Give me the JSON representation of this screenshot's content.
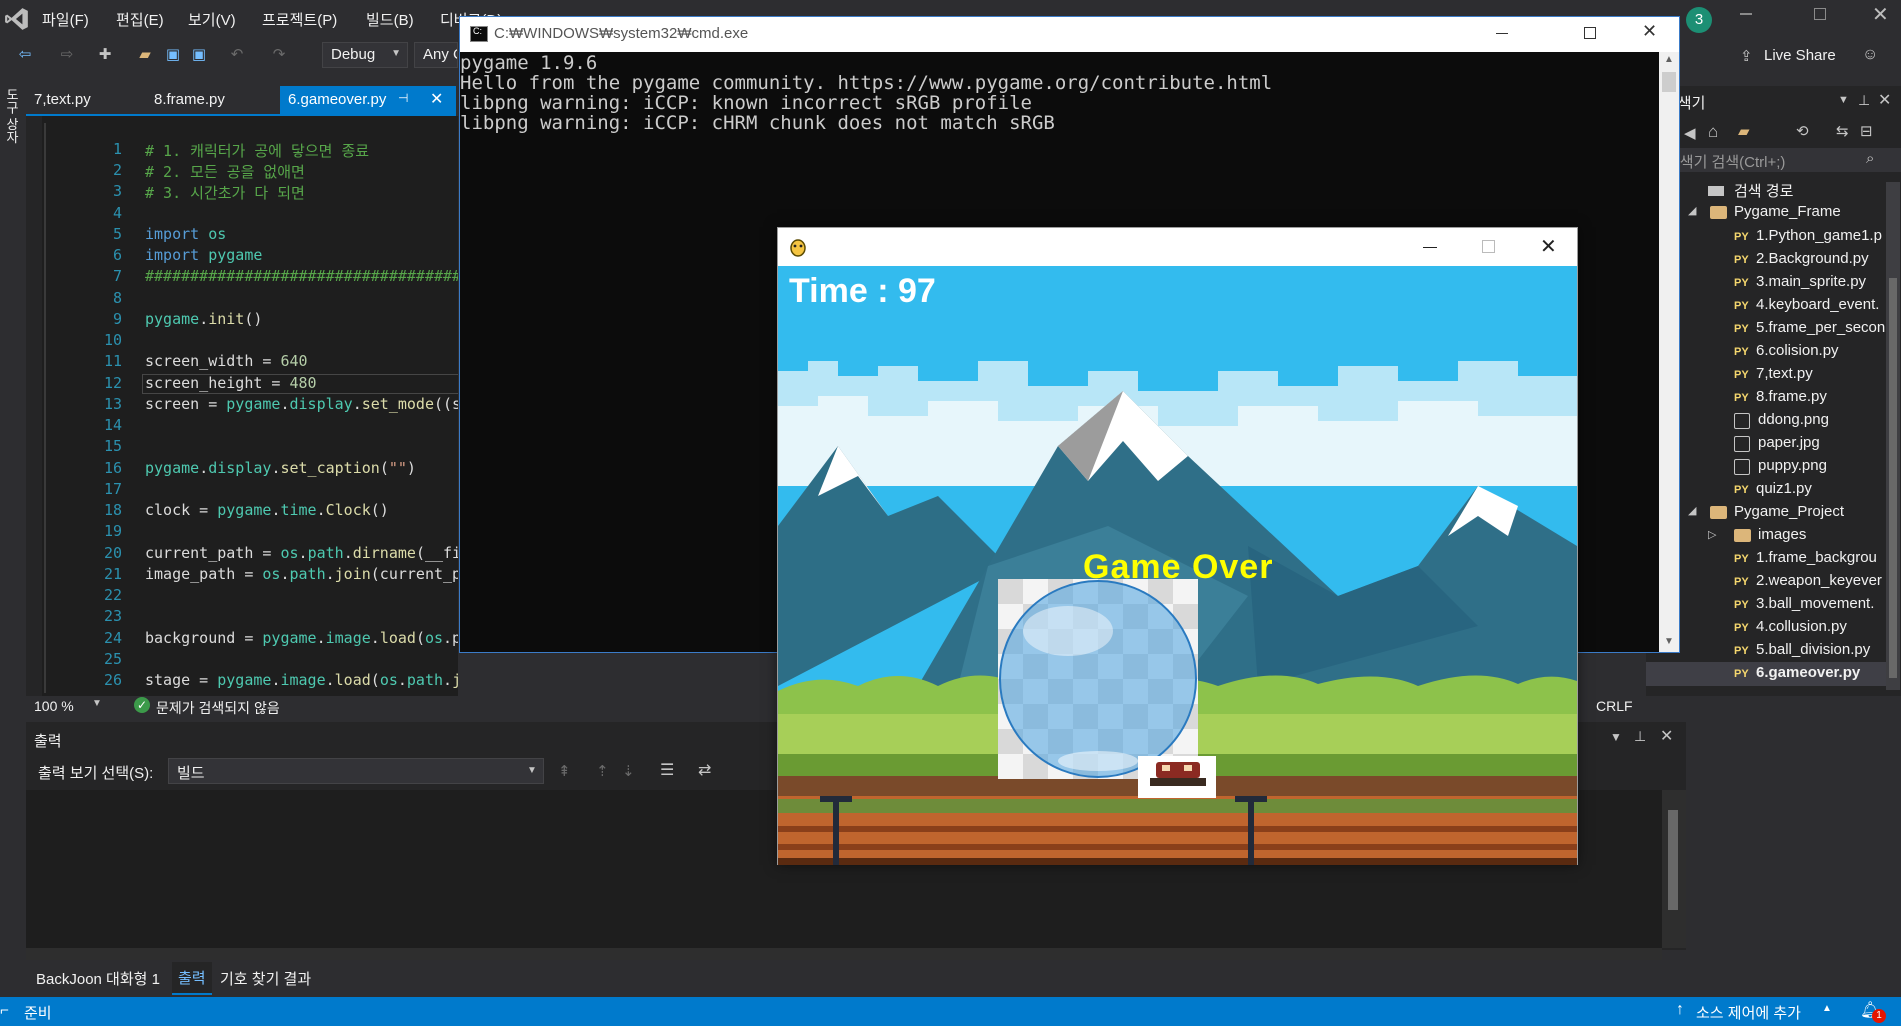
{
  "menu": {
    "items": [
      "파일(F)",
      "편집(E)",
      "보기(V)",
      "프로젝트(P)",
      "빌드(B)",
      "디버그(D)"
    ],
    "notification_count": "3",
    "live_share": "Live Share"
  },
  "toolbar": {
    "config": "Debug",
    "platform": "Any C"
  },
  "left_strip": {
    "label": "도구 상자"
  },
  "tabs": [
    {
      "label": "7,text.py"
    },
    {
      "label": "8.frame.py"
    },
    {
      "label": "6.gameover.py"
    }
  ],
  "editor": {
    "line_numbers": [
      "1",
      "2",
      "3",
      "4",
      "5",
      "6",
      "7",
      "8",
      "9",
      "10",
      "11",
      "12",
      "13",
      "14",
      "15",
      "16",
      "17",
      "18",
      "19",
      "20",
      "21",
      "22",
      "23",
      "24",
      "25",
      "26"
    ],
    "zoom": "100 %",
    "issues": "문제가 검색되지 않음",
    "line_ending": "CRLF"
  },
  "output": {
    "title": "출력",
    "show_from_label": "출력 보기 선택(S):",
    "show_from_value": "빌드",
    "bottom_tabs": [
      "BackJoon 대화형 1",
      "출력",
      "기호 찾기 결과"
    ]
  },
  "statusbar": {
    "ready": "준비",
    "source_control": "소스 제어에 추가",
    "error_badge": "1"
  },
  "solution_explorer": {
    "title": "선 탐색기",
    "search_placeholder": "선 탐색기 검색(Ctrl+;)",
    "search_path": "검색 경로",
    "project1": "Pygame_Frame",
    "project1_files": [
      "1.Python_game1.p",
      "2.Background.py",
      "3.main_sprite.py",
      "4.keyboard_event.",
      "5.frame_per_secon",
      "6.colision.py",
      "7,text.py",
      "8.frame.py"
    ],
    "project1_images": [
      "ddong.png",
      "paper.jpg",
      "puppy.png"
    ],
    "project1_last": "quiz1.py",
    "project2": "Pygame_Project",
    "project2_folder": "images",
    "project2_files": [
      "1.frame_backgrou",
      "2.weapon_keyever",
      "3.ball_movement.",
      "4.collusion.py",
      "5.ball_division.py",
      "6.gameover.py"
    ],
    "py_badge": "PY"
  },
  "cmd": {
    "title": "C:₩WINDOWS₩system32₩cmd.exe",
    "lines": [
      "pygame 1.9.6",
      "Hello from the pygame community. https://www.pygame.org/contribute.html",
      "libpng warning: iCCP: known incorrect sRGB profile",
      "libpng warning: iCCP: cHRM chunk does not match sRGB"
    ]
  },
  "pygame_window": {
    "time_text": "Time : 97",
    "game_over_text": "Game Over"
  },
  "colors": {
    "vs_bg": "#2d2d30",
    "editor_bg": "#1e1e1e",
    "accent": "#007acc",
    "game_over": "#ffff00",
    "sky": "#33bbee"
  }
}
